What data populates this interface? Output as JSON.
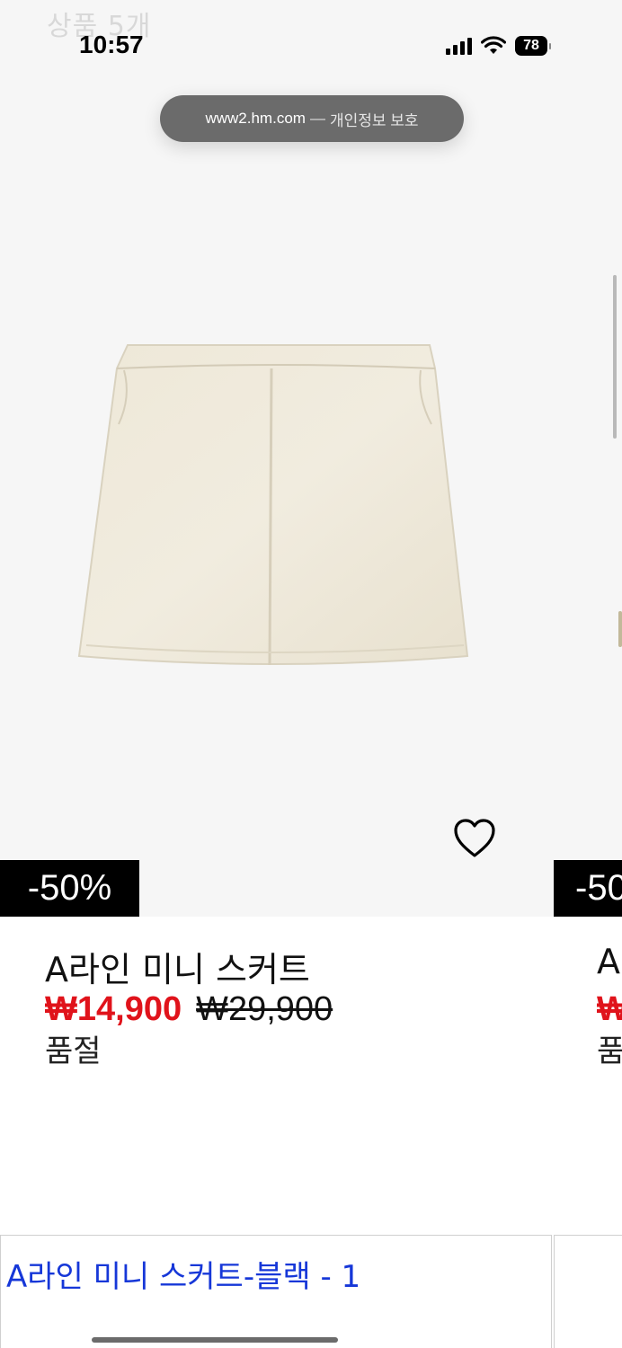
{
  "header": {
    "ghost_title": "상품 5개"
  },
  "status_bar": {
    "time": "10:57",
    "battery": "78"
  },
  "browser": {
    "domain": "www2.hm.com",
    "separator": "—",
    "privacy_label": "개인정보 보호"
  },
  "product": {
    "name": "A라인 미니 스커트",
    "discount_badge": "-50%",
    "sale_price": "₩14,900",
    "original_price": "₩29,900",
    "status": "품절",
    "image_alt": "cream skirt",
    "colors": {
      "sale": "#e0131b",
      "badge_bg": "#000000"
    }
  },
  "next_product_peek": {
    "badge": "-50",
    "name": "A",
    "price": "₩",
    "status": "품"
  },
  "link": {
    "text": "A라인 미니 스커트-블랙 - 1",
    "color": "#1637d8"
  }
}
